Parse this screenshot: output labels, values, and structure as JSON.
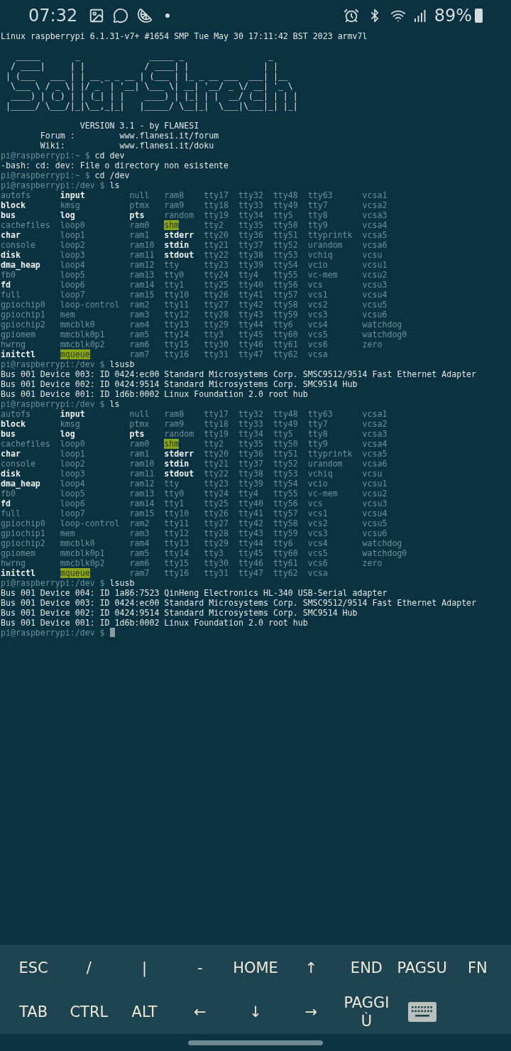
{
  "status_bar": {
    "time": "07:32",
    "battery": "89%"
  },
  "terminal": {
    "lines": [
      {
        "kind": "text",
        "text": "Linux raspberrypi 6.1.31-v7+ #1654 SMP Tue May 30 17:11:42 BST 2023 armv7l"
      },
      {
        "kind": "blank"
      },
      {
        "kind": "text",
        "text": "   _____       _              _____ _                 _"
      },
      {
        "kind": "text",
        "text": "  / ____|     | |            / ____| |               | |"
      },
      {
        "kind": "text",
        "text": " | (___   ___ | | __ _ _ __ | (___ | |_ _ __ ___  ___| |__"
      },
      {
        "kind": "text",
        "text": "  \\___ \\ / _ \\| |/ _` | '__| \\___ \\| __| '__/ _ \\/ __| '_ \\"
      },
      {
        "kind": "text",
        "text": "  ____) | (_) | | (_| | |    ____) | |_| | |  __/ (__| | | |"
      },
      {
        "kind": "text",
        "text": " |_____/ \\___/|_|\\__,_|_|   |_____/ \\__|_|  \\___|\\___|_| |_|"
      },
      {
        "kind": "blank"
      },
      {
        "kind": "text",
        "text": "                VERSION 3.1 - by FLANESI"
      },
      {
        "kind": "text",
        "text": "        Forum :         www.flanesi.it/forum"
      },
      {
        "kind": "text",
        "text": "        Wiki:           www.flanesi.it/doku"
      },
      {
        "kind": "prompt",
        "prompt": "pi@raspberrypi:~ $",
        "command": "cd dev"
      },
      {
        "kind": "text",
        "text": "-bash: cd: dev: File o directory non esistente"
      },
      {
        "kind": "prompt",
        "prompt": "pi@raspberrypi:~ $",
        "command": "cd /dev"
      },
      {
        "kind": "prompt",
        "prompt": "pi@raspberrypi:/dev $",
        "command": "ls"
      },
      {
        "kind": "listing",
        "columns": [
          [
            {
              "name": "autofs",
              "kind": "file"
            },
            {
              "name": "block",
              "kind": "dir"
            },
            {
              "name": "bus",
              "kind": "dir"
            },
            {
              "name": "cachefiles",
              "kind": "file"
            },
            {
              "name": "char",
              "kind": "dir"
            },
            {
              "name": "console",
              "kind": "file"
            },
            {
              "name": "disk",
              "kind": "dir"
            },
            {
              "name": "dma_heap",
              "kind": "dir"
            },
            {
              "name": "fb0",
              "kind": "file"
            },
            {
              "name": "fd",
              "kind": "dir"
            },
            {
              "name": "full",
              "kind": "file"
            },
            {
              "name": "gpiochip0",
              "kind": "file"
            },
            {
              "name": "gpiochip1",
              "kind": "file"
            },
            {
              "name": "gpiochip2",
              "kind": "file"
            },
            {
              "name": "gpiomem",
              "kind": "file"
            },
            {
              "name": "hwrng",
              "kind": "file"
            },
            {
              "name": "initctl",
              "kind": "dir"
            }
          ],
          [
            {
              "name": "input",
              "kind": "dir"
            },
            {
              "name": "kmsg",
              "kind": "file"
            },
            {
              "name": "log",
              "kind": "dir"
            },
            {
              "name": "loop0",
              "kind": "file"
            },
            {
              "name": "loop1",
              "kind": "file"
            },
            {
              "name": "loop2",
              "kind": "file"
            },
            {
              "name": "loop3",
              "kind": "file"
            },
            {
              "name": "loop4",
              "kind": "file"
            },
            {
              "name": "loop5",
              "kind": "file"
            },
            {
              "name": "loop6",
              "kind": "file"
            },
            {
              "name": "loop7",
              "kind": "file"
            },
            {
              "name": "loop-control",
              "kind": "file"
            },
            {
              "name": "mem",
              "kind": "file"
            },
            {
              "name": "mmcblk0",
              "kind": "file"
            },
            {
              "name": "mmcblk0p1",
              "kind": "file"
            },
            {
              "name": "mmcblk0p2",
              "kind": "file"
            },
            {
              "name": "mqueue",
              "kind": "sticky"
            }
          ],
          [
            {
              "name": "null",
              "kind": "file"
            },
            {
              "name": "ptmx",
              "kind": "file"
            },
            {
              "name": "pts",
              "kind": "dir"
            },
            {
              "name": "ram0",
              "kind": "file"
            },
            {
              "name": "ram1",
              "kind": "file"
            },
            {
              "name": "ram10",
              "kind": "file"
            },
            {
              "name": "ram11",
              "kind": "file"
            },
            {
              "name": "ram12",
              "kind": "file"
            },
            {
              "name": "ram13",
              "kind": "file"
            },
            {
              "name": "ram14",
              "kind": "file"
            },
            {
              "name": "ram15",
              "kind": "file"
            },
            {
              "name": "ram2",
              "kind": "file"
            },
            {
              "name": "ram3",
              "kind": "file"
            },
            {
              "name": "ram4",
              "kind": "file"
            },
            {
              "name": "ram5",
              "kind": "file"
            },
            {
              "name": "ram6",
              "kind": "file"
            },
            {
              "name": "ram7",
              "kind": "file"
            }
          ],
          [
            {
              "name": "ram8",
              "kind": "file"
            },
            {
              "name": "ram9",
              "kind": "file"
            },
            {
              "name": "random",
              "kind": "file"
            },
            {
              "name": "shm",
              "kind": "sticky"
            },
            {
              "name": "stderr",
              "kind": "dir"
            },
            {
              "name": "stdin",
              "kind": "dir"
            },
            {
              "name": "stdout",
              "kind": "dir"
            },
            {
              "name": "tty",
              "kind": "file"
            },
            {
              "name": "tty0",
              "kind": "file"
            },
            {
              "name": "tty1",
              "kind": "file"
            },
            {
              "name": "tty10",
              "kind": "file"
            },
            {
              "name": "tty11",
              "kind": "file"
            },
            {
              "name": "tty12",
              "kind": "file"
            },
            {
              "name": "tty13",
              "kind": "file"
            },
            {
              "name": "tty14",
              "kind": "file"
            },
            {
              "name": "tty15",
              "kind": "file"
            },
            {
              "name": "tty16",
              "kind": "file"
            }
          ],
          [
            {
              "name": "tty17",
              "kind": "file"
            },
            {
              "name": "tty18",
              "kind": "file"
            },
            {
              "name": "tty19",
              "kind": "file"
            },
            {
              "name": "tty2",
              "kind": "file"
            },
            {
              "name": "tty20",
              "kind": "file"
            },
            {
              "name": "tty21",
              "kind": "file"
            },
            {
              "name": "tty22",
              "kind": "file"
            },
            {
              "name": "tty23",
              "kind": "file"
            },
            {
              "name": "tty24",
              "kind": "file"
            },
            {
              "name": "tty25",
              "kind": "file"
            },
            {
              "name": "tty26",
              "kind": "file"
            },
            {
              "name": "tty27",
              "kind": "file"
            },
            {
              "name": "tty28",
              "kind": "file"
            },
            {
              "name": "tty29",
              "kind": "file"
            },
            {
              "name": "tty3",
              "kind": "file"
            },
            {
              "name": "tty30",
              "kind": "file"
            },
            {
              "name": "tty31",
              "kind": "file"
            }
          ],
          [
            {
              "name": "tty32",
              "kind": "file"
            },
            {
              "name": "tty33",
              "kind": "file"
            },
            {
              "name": "tty34",
              "kind": "file"
            },
            {
              "name": "tty35",
              "kind": "file"
            },
            {
              "name": "tty36",
              "kind": "file"
            },
            {
              "name": "tty37",
              "kind": "file"
            },
            {
              "name": "tty38",
              "kind": "file"
            },
            {
              "name": "tty39",
              "kind": "file"
            },
            {
              "name": "tty4",
              "kind": "file"
            },
            {
              "name": "tty40",
              "kind": "file"
            },
            {
              "name": "tty41",
              "kind": "file"
            },
            {
              "name": "tty42",
              "kind": "file"
            },
            {
              "name": "tty43",
              "kind": "file"
            },
            {
              "name": "tty44",
              "kind": "file"
            },
            {
              "name": "tty45",
              "kind": "file"
            },
            {
              "name": "tty46",
              "kind": "file"
            },
            {
              "name": "tty47",
              "kind": "file"
            }
          ],
          [
            {
              "name": "tty48",
              "kind": "file"
            },
            {
              "name": "tty49",
              "kind": "file"
            },
            {
              "name": "tty5",
              "kind": "file"
            },
            {
              "name": "tty50",
              "kind": "file"
            },
            {
              "name": "tty51",
              "kind": "file"
            },
            {
              "name": "tty52",
              "kind": "file"
            },
            {
              "name": "tty53",
              "kind": "file"
            },
            {
              "name": "tty54",
              "kind": "file"
            },
            {
              "name": "tty55",
              "kind": "file"
            },
            {
              "name": "tty56",
              "kind": "file"
            },
            {
              "name": "tty57",
              "kind": "file"
            },
            {
              "name": "tty58",
              "kind": "file"
            },
            {
              "name": "tty59",
              "kind": "file"
            },
            {
              "name": "tty6",
              "kind": "file"
            },
            {
              "name": "tty60",
              "kind": "file"
            },
            {
              "name": "tty61",
              "kind": "file"
            },
            {
              "name": "tty62",
              "kind": "file"
            }
          ],
          [
            {
              "name": "tty63",
              "kind": "file"
            },
            {
              "name": "tty7",
              "kind": "file"
            },
            {
              "name": "tty8",
              "kind": "file"
            },
            {
              "name": "tty9",
              "kind": "file"
            },
            {
              "name": "ttyprintk",
              "kind": "file"
            },
            {
              "name": "urandom",
              "kind": "file"
            },
            {
              "name": "vchiq",
              "kind": "file"
            },
            {
              "name": "vcio",
              "kind": "file"
            },
            {
              "name": "vc-mem",
              "kind": "file"
            },
            {
              "name": "vcs",
              "kind": "file"
            },
            {
              "name": "vcs1",
              "kind": "file"
            },
            {
              "name": "vcs2",
              "kind": "file"
            },
            {
              "name": "vcs3",
              "kind": "file"
            },
            {
              "name": "vcs4",
              "kind": "file"
            },
            {
              "name": "vcs5",
              "kind": "file"
            },
            {
              "name": "vcs6",
              "kind": "file"
            },
            {
              "name": "vcsa",
              "kind": "file"
            }
          ],
          [
            {
              "name": "vcsa1",
              "kind": "file"
            },
            {
              "name": "vcsa2",
              "kind": "file"
            },
            {
              "name": "vcsa3",
              "kind": "file"
            },
            {
              "name": "vcsa4",
              "kind": "file"
            },
            {
              "name": "vcsa5",
              "kind": "file"
            },
            {
              "name": "vcsa6",
              "kind": "file"
            },
            {
              "name": "vcsu",
              "kind": "file"
            },
            {
              "name": "vcsu1",
              "kind": "file"
            },
            {
              "name": "vcsu2",
              "kind": "file"
            },
            {
              "name": "vcsu3",
              "kind": "file"
            },
            {
              "name": "vcsu4",
              "kind": "file"
            },
            {
              "name": "vcsu5",
              "kind": "file"
            },
            {
              "name": "vcsu6",
              "kind": "file"
            },
            {
              "name": "watchdog",
              "kind": "file"
            },
            {
              "name": "watchdog0",
              "kind": "file"
            },
            {
              "name": "zero",
              "kind": "file"
            }
          ]
        ]
      },
      {
        "kind": "prompt",
        "prompt": "pi@raspberrypi:/dev $",
        "command": "lsusb"
      },
      {
        "kind": "text",
        "text": "Bus 001 Device 003: ID 0424:ec00 Standard Microsystems Corp. SMSC9512/9514 Fast Ethernet Adapter"
      },
      {
        "kind": "text",
        "text": "Bus 001 Device 002: ID 0424:9514 Standard Microsystems Corp. SMC9514 Hub"
      },
      {
        "kind": "text",
        "text": "Bus 001 Device 001: ID 1d6b:0002 Linux Foundation 2.0 root hub"
      },
      {
        "kind": "prompt",
        "prompt": "pi@raspberrypi:/dev $",
        "command": "ls"
      },
      {
        "kind": "listing",
        "columns": [
          [
            {
              "name": "autofs",
              "kind": "file"
            },
            {
              "name": "block",
              "kind": "dir"
            },
            {
              "name": "bus",
              "kind": "dir"
            },
            {
              "name": "cachefiles",
              "kind": "file"
            },
            {
              "name": "char",
              "kind": "dir"
            },
            {
              "name": "console",
              "kind": "file"
            },
            {
              "name": "disk",
              "kind": "dir"
            },
            {
              "name": "dma_heap",
              "kind": "dir"
            },
            {
              "name": "fb0",
              "kind": "file"
            },
            {
              "name": "fd",
              "kind": "dir"
            },
            {
              "name": "full",
              "kind": "file"
            },
            {
              "name": "gpiochip0",
              "kind": "file"
            },
            {
              "name": "gpiochip1",
              "kind": "file"
            },
            {
              "name": "gpiochip2",
              "kind": "file"
            },
            {
              "name": "gpiomem",
              "kind": "file"
            },
            {
              "name": "hwrng",
              "kind": "file"
            },
            {
              "name": "initctl",
              "kind": "dir"
            }
          ],
          [
            {
              "name": "input",
              "kind": "dir"
            },
            {
              "name": "kmsg",
              "kind": "file"
            },
            {
              "name": "log",
              "kind": "dir"
            },
            {
              "name": "loop0",
              "kind": "file"
            },
            {
              "name": "loop1",
              "kind": "file"
            },
            {
              "name": "loop2",
              "kind": "file"
            },
            {
              "name": "loop3",
              "kind": "file"
            },
            {
              "name": "loop4",
              "kind": "file"
            },
            {
              "name": "loop5",
              "kind": "file"
            },
            {
              "name": "loop6",
              "kind": "file"
            },
            {
              "name": "loop7",
              "kind": "file"
            },
            {
              "name": "loop-control",
              "kind": "file"
            },
            {
              "name": "mem",
              "kind": "file"
            },
            {
              "name": "mmcblk0",
              "kind": "file"
            },
            {
              "name": "mmcblk0p1",
              "kind": "file"
            },
            {
              "name": "mmcblk0p2",
              "kind": "file"
            },
            {
              "name": "mqueue",
              "kind": "sticky"
            }
          ],
          [
            {
              "name": "null",
              "kind": "file"
            },
            {
              "name": "ptmx",
              "kind": "file"
            },
            {
              "name": "pts",
              "kind": "dir"
            },
            {
              "name": "ram0",
              "kind": "file"
            },
            {
              "name": "ram1",
              "kind": "file"
            },
            {
              "name": "ram10",
              "kind": "file"
            },
            {
              "name": "ram11",
              "kind": "file"
            },
            {
              "name": "ram12",
              "kind": "file"
            },
            {
              "name": "ram13",
              "kind": "file"
            },
            {
              "name": "ram14",
              "kind": "file"
            },
            {
              "name": "ram15",
              "kind": "file"
            },
            {
              "name": "ram2",
              "kind": "file"
            },
            {
              "name": "ram3",
              "kind": "file"
            },
            {
              "name": "ram4",
              "kind": "file"
            },
            {
              "name": "ram5",
              "kind": "file"
            },
            {
              "name": "ram6",
              "kind": "file"
            },
            {
              "name": "ram7",
              "kind": "file"
            }
          ],
          [
            {
              "name": "ram8",
              "kind": "file"
            },
            {
              "name": "ram9",
              "kind": "file"
            },
            {
              "name": "random",
              "kind": "file"
            },
            {
              "name": "shm",
              "kind": "sticky"
            },
            {
              "name": "stderr",
              "kind": "dir"
            },
            {
              "name": "stdin",
              "kind": "dir"
            },
            {
              "name": "stdout",
              "kind": "dir"
            },
            {
              "name": "tty",
              "kind": "file"
            },
            {
              "name": "tty0",
              "kind": "file"
            },
            {
              "name": "tty1",
              "kind": "file"
            },
            {
              "name": "tty10",
              "kind": "file"
            },
            {
              "name": "tty11",
              "kind": "file"
            },
            {
              "name": "tty12",
              "kind": "file"
            },
            {
              "name": "tty13",
              "kind": "file"
            },
            {
              "name": "tty14",
              "kind": "file"
            },
            {
              "name": "tty15",
              "kind": "file"
            },
            {
              "name": "tty16",
              "kind": "file"
            }
          ],
          [
            {
              "name": "tty17",
              "kind": "file"
            },
            {
              "name": "tty18",
              "kind": "file"
            },
            {
              "name": "tty19",
              "kind": "file"
            },
            {
              "name": "tty2",
              "kind": "file"
            },
            {
              "name": "tty20",
              "kind": "file"
            },
            {
              "name": "tty21",
              "kind": "file"
            },
            {
              "name": "tty22",
              "kind": "file"
            },
            {
              "name": "tty23",
              "kind": "file"
            },
            {
              "name": "tty24",
              "kind": "file"
            },
            {
              "name": "tty25",
              "kind": "file"
            },
            {
              "name": "tty26",
              "kind": "file"
            },
            {
              "name": "tty27",
              "kind": "file"
            },
            {
              "name": "tty28",
              "kind": "file"
            },
            {
              "name": "tty29",
              "kind": "file"
            },
            {
              "name": "tty3",
              "kind": "file"
            },
            {
              "name": "tty30",
              "kind": "file"
            },
            {
              "name": "tty31",
              "kind": "file"
            }
          ],
          [
            {
              "name": "tty32",
              "kind": "file"
            },
            {
              "name": "tty33",
              "kind": "file"
            },
            {
              "name": "tty34",
              "kind": "file"
            },
            {
              "name": "tty35",
              "kind": "file"
            },
            {
              "name": "tty36",
              "kind": "file"
            },
            {
              "name": "tty37",
              "kind": "file"
            },
            {
              "name": "tty38",
              "kind": "file"
            },
            {
              "name": "tty39",
              "kind": "file"
            },
            {
              "name": "tty4",
              "kind": "file"
            },
            {
              "name": "tty40",
              "kind": "file"
            },
            {
              "name": "tty41",
              "kind": "file"
            },
            {
              "name": "tty42",
              "kind": "file"
            },
            {
              "name": "tty43",
              "kind": "file"
            },
            {
              "name": "tty44",
              "kind": "file"
            },
            {
              "name": "tty45",
              "kind": "file"
            },
            {
              "name": "tty46",
              "kind": "file"
            },
            {
              "name": "tty47",
              "kind": "file"
            }
          ],
          [
            {
              "name": "tty48",
              "kind": "file"
            },
            {
              "name": "tty49",
              "kind": "file"
            },
            {
              "name": "tty5",
              "kind": "file"
            },
            {
              "name": "tty50",
              "kind": "file"
            },
            {
              "name": "tty51",
              "kind": "file"
            },
            {
              "name": "tty52",
              "kind": "file"
            },
            {
              "name": "tty53",
              "kind": "file"
            },
            {
              "name": "tty54",
              "kind": "file"
            },
            {
              "name": "tty55",
              "kind": "file"
            },
            {
              "name": "tty56",
              "kind": "file"
            },
            {
              "name": "tty57",
              "kind": "file"
            },
            {
              "name": "tty58",
              "kind": "file"
            },
            {
              "name": "tty59",
              "kind": "file"
            },
            {
              "name": "tty6",
              "kind": "file"
            },
            {
              "name": "tty60",
              "kind": "file"
            },
            {
              "name": "tty61",
              "kind": "file"
            },
            {
              "name": "tty62",
              "kind": "file"
            }
          ],
          [
            {
              "name": "tty63",
              "kind": "file"
            },
            {
              "name": "tty7",
              "kind": "file"
            },
            {
              "name": "tty8",
              "kind": "file"
            },
            {
              "name": "tty9",
              "kind": "file"
            },
            {
              "name": "ttyprintk",
              "kind": "file"
            },
            {
              "name": "urandom",
              "kind": "file"
            },
            {
              "name": "vchiq",
              "kind": "file"
            },
            {
              "name": "vcio",
              "kind": "file"
            },
            {
              "name": "vc-mem",
              "kind": "file"
            },
            {
              "name": "vcs",
              "kind": "file"
            },
            {
              "name": "vcs1",
              "kind": "file"
            },
            {
              "name": "vcs2",
              "kind": "file"
            },
            {
              "name": "vcs3",
              "kind": "file"
            },
            {
              "name": "vcs4",
              "kind": "file"
            },
            {
              "name": "vcs5",
              "kind": "file"
            },
            {
              "name": "vcs6",
              "kind": "file"
            },
            {
              "name": "vcsa",
              "kind": "file"
            }
          ],
          [
            {
              "name": "vcsa1",
              "kind": "file"
            },
            {
              "name": "vcsa2",
              "kind": "file"
            },
            {
              "name": "vcsa3",
              "kind": "file"
            },
            {
              "name": "vcsa4",
              "kind": "file"
            },
            {
              "name": "vcsa5",
              "kind": "file"
            },
            {
              "name": "vcsa6",
              "kind": "file"
            },
            {
              "name": "vcsu",
              "kind": "file"
            },
            {
              "name": "vcsu1",
              "kind": "file"
            },
            {
              "name": "vcsu2",
              "kind": "file"
            },
            {
              "name": "vcsu3",
              "kind": "file"
            },
            {
              "name": "vcsu4",
              "kind": "file"
            },
            {
              "name": "vcsu5",
              "kind": "file"
            },
            {
              "name": "vcsu6",
              "kind": "file"
            },
            {
              "name": "watchdog",
              "kind": "file"
            },
            {
              "name": "watchdog0",
              "kind": "file"
            },
            {
              "name": "zero",
              "kind": "file"
            }
          ]
        ]
      },
      {
        "kind": "prompt",
        "prompt": "pi@raspberrypi:/dev $",
        "command": "lsusb"
      },
      {
        "kind": "text",
        "text": "Bus 001 Device 004: ID 1a86:7523 QinHeng Electronics HL-340 USB-Serial adapter"
      },
      {
        "kind": "text",
        "text": "Bus 001 Device 003: ID 0424:ec00 Standard Microsystems Corp. SMSC9512/9514 Fast Ethernet Adapter"
      },
      {
        "kind": "text",
        "text": "Bus 001 Device 002: ID 0424:9514 Standard Microsystems Corp. SMC9514 Hub"
      },
      {
        "kind": "text",
        "text": "Bus 001 Device 001: ID 1d6b:0002 Linux Foundation 2.0 root hub"
      },
      {
        "kind": "prompt",
        "prompt": "pi@raspberrypi:/dev $",
        "cursor": true
      }
    ]
  },
  "extra_keys": [
    [
      {
        "kind": "key",
        "label": "ESC"
      },
      {
        "kind": "key",
        "label": "/"
      },
      {
        "kind": "key",
        "label": "|"
      },
      {
        "kind": "key",
        "label": "-"
      },
      {
        "kind": "key",
        "label": "HOME"
      },
      {
        "kind": "key",
        "label": "↑"
      },
      {
        "kind": "key",
        "label": "END"
      },
      {
        "kind": "key",
        "label": "PAGSU"
      },
      {
        "kind": "key",
        "label": "FN"
      }
    ],
    [
      {
        "kind": "key",
        "label": "TAB"
      },
      {
        "kind": "key",
        "label": "CTRL"
      },
      {
        "kind": "key",
        "label": "ALT"
      },
      {
        "kind": "key",
        "label": "←"
      },
      {
        "kind": "key",
        "label": "↓"
      },
      {
        "kind": "key",
        "label": "→"
      },
      {
        "kind": "key",
        "label": "PAGGIÙ"
      },
      {
        "kind": "keyboard"
      }
    ]
  ]
}
